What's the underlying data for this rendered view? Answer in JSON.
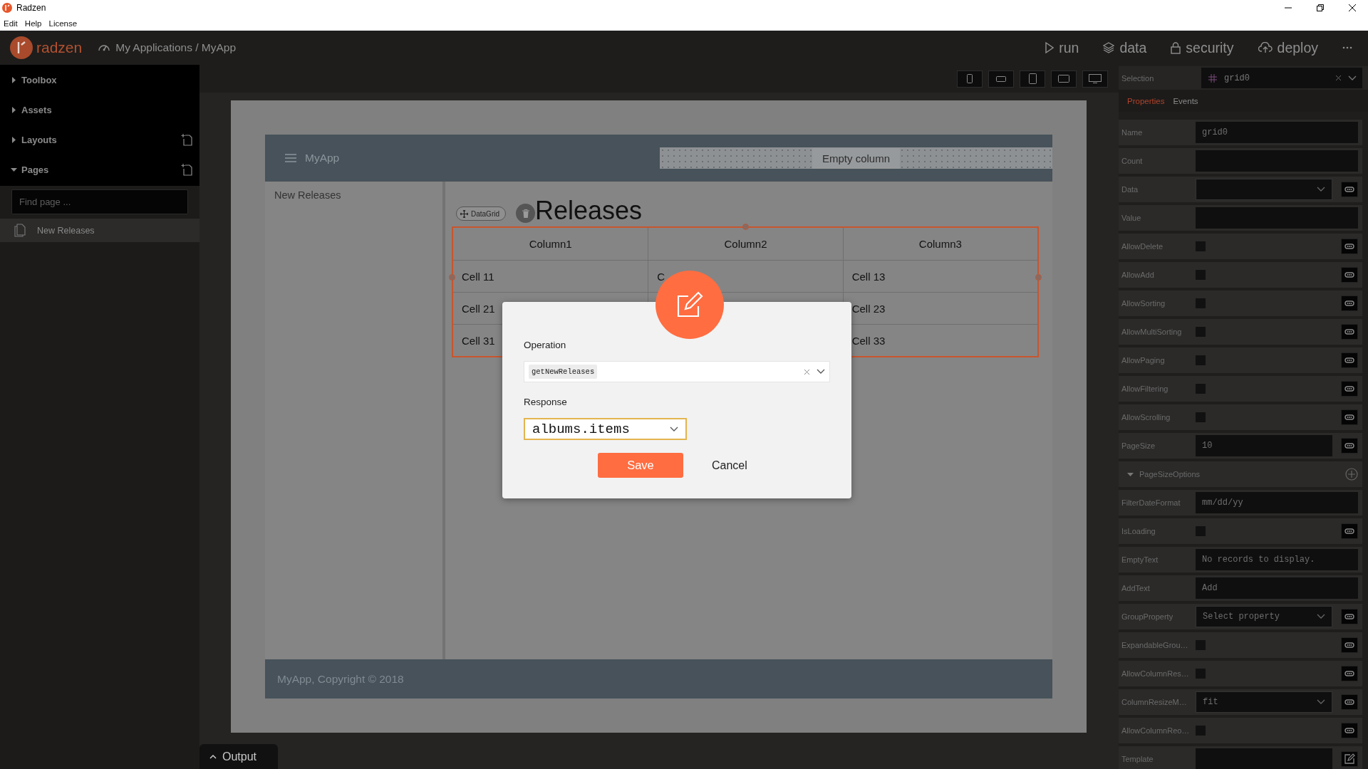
{
  "title_bar": {
    "title": "Radzen"
  },
  "menu": [
    "Edit",
    "Help",
    "License"
  ],
  "header": {
    "logo": "radzen",
    "breadcrumb": "My Applications / MyApp",
    "nav": [
      "run",
      "data",
      "security",
      "deploy"
    ]
  },
  "sidebar": {
    "sections": [
      {
        "label": "Toolbox",
        "expanded": false,
        "add_button": false
      },
      {
        "label": "Assets",
        "expanded": false,
        "add_button": false
      },
      {
        "label": "Layouts",
        "expanded": false,
        "add_button": true
      },
      {
        "label": "Pages",
        "expanded": true,
        "add_button": true
      }
    ],
    "search": {
      "placeholder": "Find page ..."
    },
    "pages": [
      {
        "label": "New Releases",
        "selected": true
      }
    ]
  },
  "app": {
    "title": "MyApp",
    "empty_column": "Empty column",
    "nav": [
      "New Releases"
    ],
    "heading": "Releases",
    "component_badge": "DataGrid",
    "grid": {
      "columns": [
        "Column1",
        "Column2",
        "Column3"
      ],
      "rows": [
        [
          "Cell 11",
          "C",
          "Cell 13"
        ],
        [
          "Cell 21",
          null,
          "Cell 23"
        ],
        [
          "Cell 31",
          null,
          "Cell 33"
        ]
      ]
    },
    "footer": "MyApp, Copyright © 2018"
  },
  "dialog": {
    "fields": [
      {
        "label": "Operation",
        "kind": "chip-select",
        "value": "getNewReleases"
      },
      {
        "label": "Response",
        "kind": "select",
        "value": "albums.items"
      }
    ],
    "buttons": [
      {
        "label": "Save",
        "kind": "primary"
      },
      {
        "label": "Cancel",
        "kind": "text"
      }
    ]
  },
  "properties": {
    "selection": {
      "label": "Selection",
      "value": "grid0"
    },
    "tabs": [
      {
        "label": "Properties",
        "selected": true
      },
      {
        "label": "Events",
        "selected": false
      }
    ],
    "rows": [
      {
        "label": "Name",
        "kind": "text",
        "value": "grid0",
        "bindable": false
      },
      {
        "label": "Count",
        "kind": "text",
        "bindable": false
      },
      {
        "label": "Data",
        "kind": "select",
        "bindable": true
      },
      {
        "label": "Value",
        "kind": "text",
        "bindable": false
      },
      {
        "label": "AllowDelete",
        "kind": "checkbox",
        "checked": false,
        "bindable": true
      },
      {
        "label": "AllowAdd",
        "kind": "checkbox",
        "checked": false,
        "bindable": true
      },
      {
        "label": "AllowSorting",
        "kind": "checkbox",
        "checked": false,
        "bindable": true
      },
      {
        "label": "AllowMultiSorting",
        "kind": "checkbox",
        "checked": false,
        "bindable": true
      },
      {
        "label": "AllowPaging",
        "kind": "checkbox",
        "checked": false,
        "bindable": true
      },
      {
        "label": "AllowFiltering",
        "kind": "checkbox",
        "checked": false,
        "bindable": true
      },
      {
        "label": "AllowScrolling",
        "kind": "checkbox",
        "checked": false,
        "bindable": true
      },
      {
        "label": "PageSize",
        "kind": "text",
        "value": "10",
        "bindable": true
      },
      {
        "label": "PageSizeOptions",
        "kind": "group",
        "expanded": true
      },
      {
        "label": "FilterDateFormat",
        "kind": "text",
        "value": "mm/dd/yy",
        "bindable": false
      },
      {
        "label": "IsLoading",
        "kind": "checkbox",
        "checked": false,
        "bindable": true
      },
      {
        "label": "EmptyText",
        "kind": "text",
        "value": "No records to display.",
        "bindable": false
      },
      {
        "label": "AddText",
        "kind": "text",
        "value": "Add",
        "bindable": false
      },
      {
        "label": "GroupProperty",
        "kind": "select",
        "placeholder": "Select property",
        "bindable": true
      },
      {
        "label": "ExpandableGrou…",
        "kind": "checkbox",
        "checked": false,
        "bindable": true
      },
      {
        "label": "AllowColumnRes…",
        "kind": "checkbox",
        "checked": false,
        "bindable": true
      },
      {
        "label": "ColumnResizeM…",
        "kind": "select",
        "value": "fit",
        "bindable": true
      },
      {
        "label": "AllowColumnReo…",
        "kind": "checkbox",
        "checked": false,
        "bindable": true
      },
      {
        "label": "Template",
        "kind": "template"
      }
    ]
  },
  "output": {
    "label": "Output"
  }
}
